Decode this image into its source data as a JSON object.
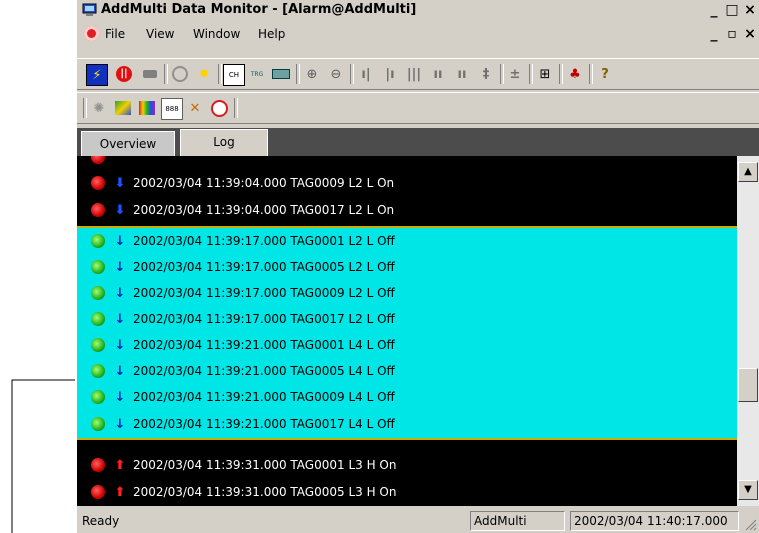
{
  "window": {
    "title": "AddMulti Data Monitor - [Alarm@AddMulti]",
    "controls": [
      "_",
      "□",
      "×"
    ]
  },
  "menu": {
    "items": [
      "File",
      "View",
      "Window",
      "Help"
    ],
    "mdi_controls": [
      "_",
      "▫",
      "×"
    ]
  },
  "toolbar1": {
    "buttons": [
      {
        "name": "lightning-icon"
      },
      {
        "name": "stop-icon"
      },
      {
        "name": "record-icon"
      },
      {
        "name": "circle-icon"
      },
      {
        "name": "spark-icon"
      },
      {
        "name": "ch-icon",
        "label": "CH"
      },
      {
        "name": "trg-icon",
        "label": "TRG"
      },
      {
        "name": "bar-icon"
      },
      {
        "name": "zoom-in-icon"
      },
      {
        "name": "zoom-out-icon"
      },
      {
        "name": "bars-1-icon"
      },
      {
        "name": "bars-2-icon"
      },
      {
        "name": "bars-3-icon"
      },
      {
        "name": "bars-4-icon"
      },
      {
        "name": "bars-5-icon"
      },
      {
        "name": "bars-6-icon"
      },
      {
        "name": "align-icon"
      },
      {
        "name": "grid-icon"
      },
      {
        "name": "alarm-icon"
      },
      {
        "name": "help-icon"
      }
    ]
  },
  "toolbar2": {
    "buttons": [
      {
        "name": "gear-icon"
      },
      {
        "name": "trend-icon"
      },
      {
        "name": "color-icon"
      },
      {
        "name": "digital-icon",
        "label": "888"
      },
      {
        "name": "cross-icon"
      },
      {
        "name": "clock-icon"
      }
    ]
  },
  "tabs": [
    {
      "label": "Overview",
      "active": false
    },
    {
      "label": "Log",
      "active": true
    }
  ],
  "log": {
    "rows": [
      {
        "state": "alarm",
        "arrow": "down",
        "text": "2002/03/04 11:39:04.000 TAG0009 L2 L  On"
      },
      {
        "state": "alarm",
        "arrow": "down",
        "text": "2002/03/04 11:39:04.000 TAG0017 L2 L  On"
      },
      {
        "state": "clear",
        "arrow": "down",
        "text": "2002/03/04 11:39:17.000 TAG0001 L2 L  Off"
      },
      {
        "state": "clear",
        "arrow": "down",
        "text": "2002/03/04 11:39:17.000 TAG0005 L2 L  Off"
      },
      {
        "state": "clear",
        "arrow": "down",
        "text": "2002/03/04 11:39:17.000 TAG0009 L2 L  Off"
      },
      {
        "state": "clear",
        "arrow": "down",
        "text": "2002/03/04 11:39:17.000 TAG0017 L2 L  Off"
      },
      {
        "state": "clear",
        "arrow": "down",
        "text": "2002/03/04 11:39:21.000 TAG0001 L4 L  Off"
      },
      {
        "state": "clear",
        "arrow": "down",
        "text": "2002/03/04 11:39:21.000 TAG0005 L4 L  Off"
      },
      {
        "state": "clear",
        "arrow": "down",
        "text": "2002/03/04 11:39:21.000 TAG0009 L4 L  Off"
      },
      {
        "state": "clear",
        "arrow": "down",
        "text": "2002/03/04 11:39:21.000 TAG0017 L4 L  Off"
      },
      {
        "state": "alarm",
        "arrow": "up",
        "text": "2002/03/04 11:39:31.000 TAG0001 L3 H  On"
      },
      {
        "state": "alarm",
        "arrow": "up",
        "text": "2002/03/04 11:39:31.000 TAG0005 L3 H  On"
      }
    ]
  },
  "status": {
    "text": "Ready",
    "pane1": "AddMulti",
    "pane2": "2002/03/04 11:40:17.000"
  },
  "colors": {
    "alarm_bg": "#000000",
    "clear_bg": "#00e6e6",
    "led_alarm": "#e00000",
    "led_clear": "#20b020"
  }
}
